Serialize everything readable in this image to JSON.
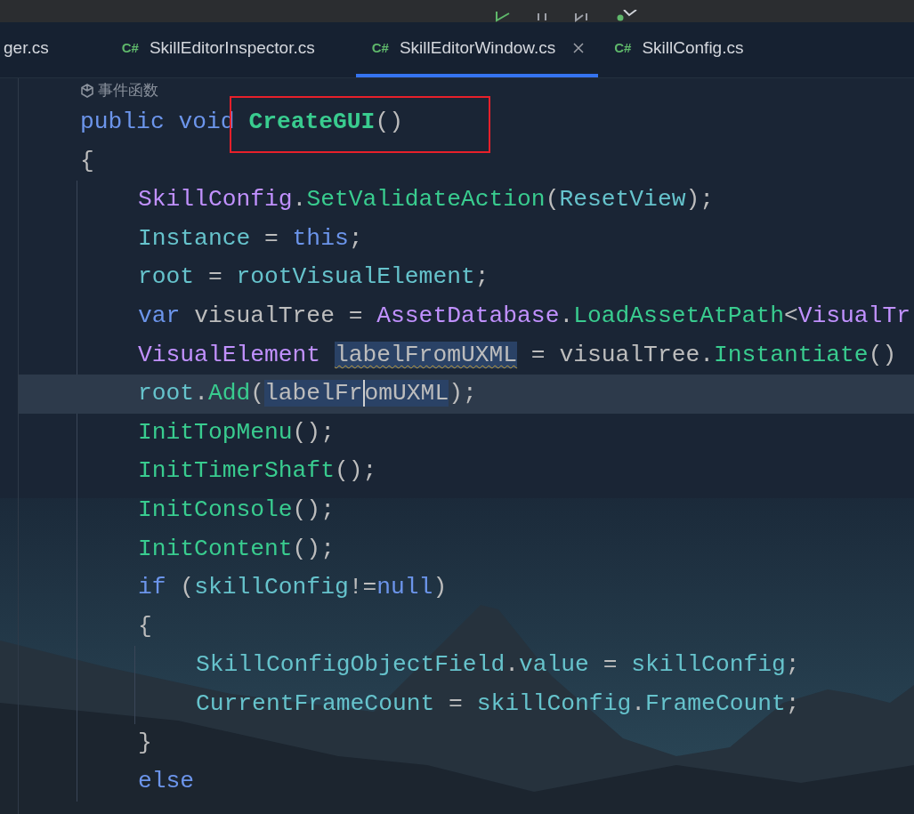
{
  "tabs": [
    {
      "label": "ger.cs",
      "selected": false
    },
    {
      "label": "SkillEditorInspector.cs",
      "lang": "C#",
      "selected": false
    },
    {
      "label": "SkillEditorWindow.cs",
      "lang": "C#",
      "selected": true
    },
    {
      "label": "SkillConfig.cs",
      "lang": "C#",
      "selected": false
    }
  ],
  "editor": {
    "hint": "事件函数",
    "lines": [
      {
        "current": false,
        "tokens": [
          {
            "kind": "keyword",
            "text": "public "
          },
          {
            "kind": "keyword",
            "text": "void "
          },
          {
            "kind": "method-decl",
            "text": "CreateGUI"
          },
          {
            "kind": "plain",
            "text": "()"
          }
        ]
      },
      {
        "current": false,
        "tokens": [
          {
            "kind": "plain",
            "text": "{"
          }
        ],
        "children": [
          {
            "current": false,
            "tokens": [
              {
                "kind": "type",
                "text": "SkillConfig"
              },
              {
                "kind": "plain",
                "text": "."
              },
              {
                "kind": "method",
                "text": "SetValidateAction"
              },
              {
                "kind": "plain",
                "text": "("
              },
              {
                "kind": "field",
                "text": "ResetView"
              },
              {
                "kind": "plain",
                "text": ");"
              }
            ]
          },
          {
            "current": false,
            "tokens": [
              {
                "kind": "field",
                "text": "Instance"
              },
              {
                "kind": "plain",
                "text": " = "
              },
              {
                "kind": "keyword",
                "text": "this"
              },
              {
                "kind": "plain",
                "text": ";"
              }
            ]
          },
          {
            "current": false,
            "tokens": [
              {
                "kind": "field",
                "text": "root"
              },
              {
                "kind": "plain",
                "text": " = "
              },
              {
                "kind": "field",
                "text": "rootVisualElement"
              },
              {
                "kind": "plain",
                "text": ";"
              }
            ]
          },
          {
            "current": false,
            "tokens": [
              {
                "kind": "keyword",
                "text": "var "
              },
              {
                "kind": "plain",
                "text": "visualTree = "
              },
              {
                "kind": "type",
                "text": "AssetDatabase"
              },
              {
                "kind": "plain",
                "text": "."
              },
              {
                "kind": "method",
                "text": "LoadAssetAtPath"
              },
              {
                "kind": "plain",
                "text": "<"
              },
              {
                "kind": "type",
                "text": "VisualTr"
              }
            ]
          },
          {
            "current": false,
            "tokens": [
              {
                "kind": "type",
                "text": "VisualElement "
              },
              {
                "kind": "plain",
                "text": "labelFromUXML",
                "highlighted": true,
                "warning": true
              },
              {
                "kind": "plain",
                "text": " = visualTree."
              },
              {
                "kind": "method",
                "text": "Instantiate"
              },
              {
                "kind": "plain",
                "text": "()"
              }
            ]
          },
          {
            "current": true,
            "tokens": [
              {
                "kind": "field",
                "text": "root"
              },
              {
                "kind": "plain",
                "text": "."
              },
              {
                "kind": "method",
                "text": "Add"
              },
              {
                "kind": "plain",
                "text": "("
              },
              {
                "kind": "plain",
                "text": "labelFr",
                "highlighted": true
              },
              {
                "kind": "plain",
                "text": "omUXML",
                "highlighted": true,
                "caret": true
              },
              {
                "kind": "plain",
                "text": ");"
              }
            ]
          },
          {
            "current": false,
            "tokens": [
              {
                "kind": "method",
                "text": "InitTopMenu"
              },
              {
                "kind": "plain",
                "text": "();"
              }
            ]
          },
          {
            "current": false,
            "tokens": [
              {
                "kind": "method",
                "text": "InitTimerShaft"
              },
              {
                "kind": "plain",
                "text": "();"
              }
            ]
          },
          {
            "current": false,
            "tokens": [
              {
                "kind": "method",
                "text": "InitConsole"
              },
              {
                "kind": "plain",
                "text": "();"
              }
            ]
          },
          {
            "current": false,
            "tokens": [
              {
                "kind": "method",
                "text": "InitContent"
              },
              {
                "kind": "plain",
                "text": "();"
              }
            ]
          },
          {
            "current": false,
            "tokens": [
              {
                "kind": "keyword",
                "text": "if "
              },
              {
                "kind": "plain",
                "text": "("
              },
              {
                "kind": "field",
                "text": "skillConfig"
              },
              {
                "kind": "plain",
                "text": "!="
              },
              {
                "kind": "keyword",
                "text": "null"
              },
              {
                "kind": "plain",
                "text": ")"
              }
            ]
          },
          {
            "current": false,
            "tokens": [
              {
                "kind": "plain",
                "text": "{"
              }
            ],
            "children": [
              {
                "current": false,
                "tokens": [
                  {
                    "kind": "field",
                    "text": "SkillConfigObjectField"
                  },
                  {
                    "kind": "plain",
                    "text": "."
                  },
                  {
                    "kind": "field",
                    "text": "value"
                  },
                  {
                    "kind": "plain",
                    "text": " = "
                  },
                  {
                    "kind": "field",
                    "text": "skillConfig"
                  },
                  {
                    "kind": "plain",
                    "text": ";"
                  }
                ]
              },
              {
                "current": false,
                "tokens": [
                  {
                    "kind": "field",
                    "text": "CurrentFrameCount"
                  },
                  {
                    "kind": "plain",
                    "text": " = "
                  },
                  {
                    "kind": "field",
                    "text": "skillConfig"
                  },
                  {
                    "kind": "plain",
                    "text": "."
                  },
                  {
                    "kind": "field",
                    "text": "FrameCount"
                  },
                  {
                    "kind": "plain",
                    "text": ";"
                  }
                ]
              }
            ]
          },
          {
            "current": false,
            "tokens": [
              {
                "kind": "plain",
                "text": "}"
              }
            ]
          },
          {
            "current": false,
            "tokens": [
              {
                "kind": "keyword",
                "text": "else"
              }
            ]
          }
        ]
      }
    ]
  }
}
